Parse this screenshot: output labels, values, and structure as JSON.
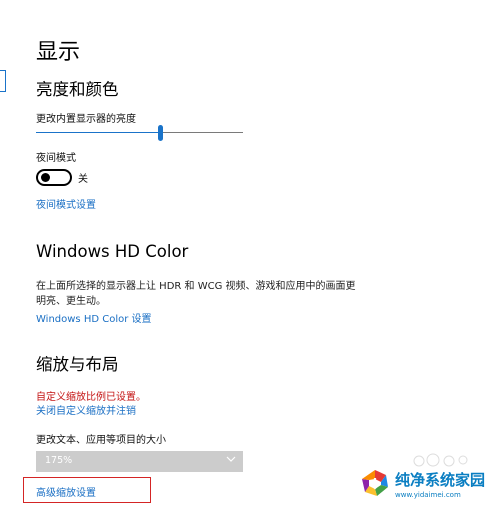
{
  "page": {
    "title": "显示"
  },
  "brightness": {
    "heading": "亮度和颜色",
    "slider_label": "更改内置显示器的亮度",
    "slider_level_percent": 60,
    "night_mode_label": "夜间模式",
    "night_mode_state": "关",
    "night_mode_settings_link": "夜间模式设置"
  },
  "hd_color": {
    "heading": "Windows HD Color",
    "description_line1": "在上面所选择的显示器上让 HDR 和 WCG 视频、游戏和应用中的画面更",
    "description_line2": "明亮、更生动。",
    "settings_link": "Windows HD Color 设置"
  },
  "scale": {
    "heading": "缩放与布局",
    "custom_scale_notice": "自定义缩放比例已设置。",
    "sign_out_link": "关闭自定义缩放并注销",
    "size_label": "更改文本、应用等项目的大小",
    "size_value": "175%",
    "advanced_link": "高级缩放设置"
  },
  "watermark": {
    "text": "纯净系统家园",
    "url": "www.yidaimei.com"
  },
  "colors": {
    "accent": "#1a73c9",
    "link": "#1a6fc4",
    "warning": "#c41414",
    "highlight": "#d42525"
  }
}
